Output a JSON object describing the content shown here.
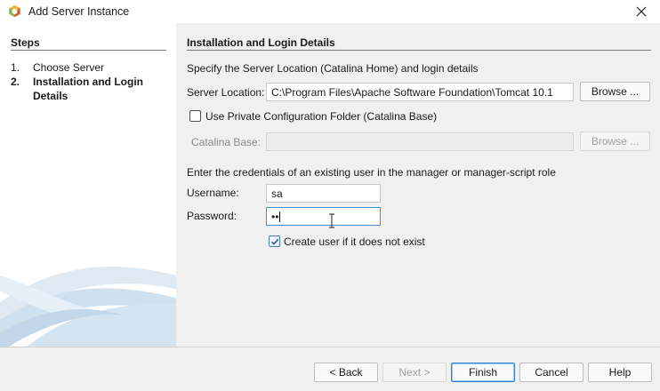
{
  "window": {
    "title": "Add Server Instance",
    "icon": "netbeans-cube-icon",
    "close_icon": "close-icon"
  },
  "steps": {
    "title": "Steps",
    "items": [
      {
        "num": "1.",
        "label": "Choose Server",
        "current": false
      },
      {
        "num": "2.",
        "label": "Installation and Login Details",
        "current": true
      }
    ]
  },
  "main": {
    "section_title": "Installation and Login Details",
    "intro": "Specify the Server Location (Catalina Home) and login details",
    "server_location": {
      "label": "Server Location:",
      "value": "C:\\Program Files\\Apache Software Foundation\\Tomcat 10.1",
      "browse_label": "Browse ..."
    },
    "private_config": {
      "label": "Use Private Configuration Folder (Catalina Base)",
      "checked": false
    },
    "catalina_base": {
      "label": "Catalina Base:",
      "value": "",
      "browse_label": "Browse ..."
    },
    "credentials_intro": "Enter the credentials of an existing user in the manager or manager-script role",
    "username": {
      "label": "Username:",
      "value": "sa"
    },
    "password": {
      "label": "Password:",
      "value": "••"
    },
    "create_user": {
      "label": "Create user if it does not exist",
      "checked": true
    }
  },
  "footer": {
    "back_label": "< Back",
    "next_label": "Next >",
    "finish_label": "Finish",
    "cancel_label": "Cancel",
    "help_label": "Help"
  },
  "colors": {
    "accent": "#2d7fd6",
    "focus_border": "#4a90d9",
    "panel_white": "#ffffff",
    "dialog_bg": "#f0f0f0"
  }
}
